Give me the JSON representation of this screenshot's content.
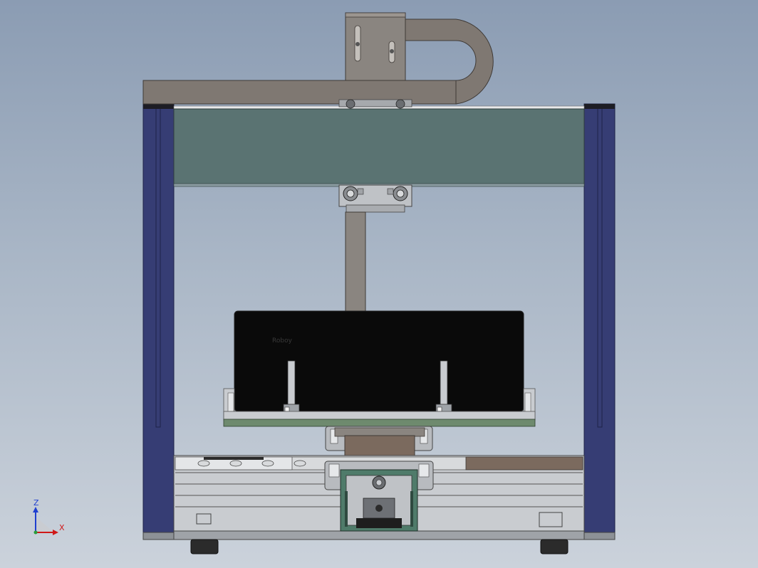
{
  "view": {
    "background_top": "#8b9cb3",
    "background_bottom": "#cbd2db"
  },
  "colors": {
    "frame_post": "#363d74",
    "frame_post_edge": "#1d2248",
    "gantry_beam": "#5a7372",
    "cable_chain": "#7f7872",
    "metal_light": "#c9ccd0",
    "metal_mid": "#9fa3a8",
    "metal_dark": "#5d6166",
    "screen": "#0a0a0a",
    "pcb_green": "#6e8a6e",
    "bronze": "#7b6a5e",
    "slot_green": "#4f7b6a",
    "foot": "#2b2b2b"
  },
  "screen_text": "Roboy",
  "triad": {
    "z_label": "Z",
    "x_label": "X",
    "z_color": "#1f3fcf",
    "x_color": "#d01818",
    "y_color": "#2a9d3a"
  }
}
